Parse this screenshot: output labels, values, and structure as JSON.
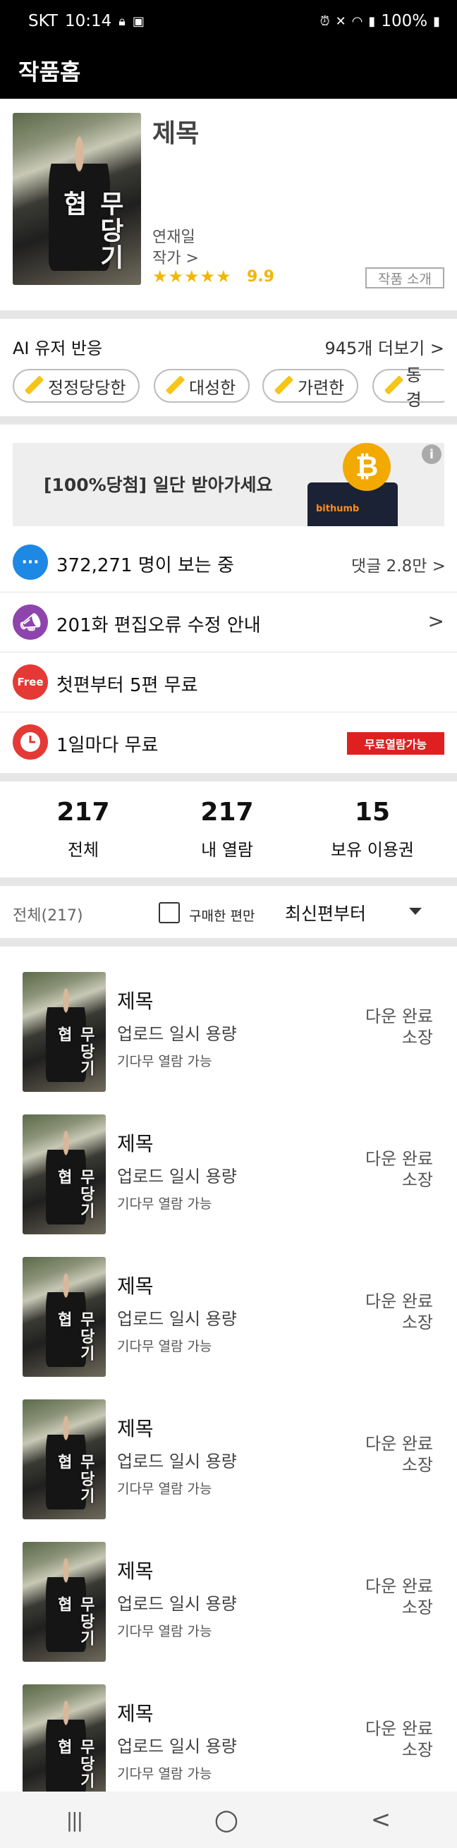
{
  "status_bar": {
    "carrier": "SKT",
    "time": "10:14",
    "battery": "100%"
  },
  "app_bar": {
    "title": "작품홈"
  },
  "work": {
    "title": "제목",
    "cover_text": "무당기협",
    "serial_day": "연재일",
    "author": "작가 >",
    "stars": "★★★★★",
    "rating": "9.9",
    "intro_button": "작품 소개"
  },
  "ai_reaction": {
    "label": "AI 유저 반응",
    "more": "945개 더보기 >",
    "chips": [
      "정정당당한",
      "대성한",
      "가련한",
      "동경"
    ]
  },
  "ad": {
    "text": "[100%당첨] 일단 받아가세요",
    "coin_label": "₿",
    "wallet_label": "bithumb",
    "info_icon": "i"
  },
  "rows": [
    {
      "icon": "chat-icon",
      "icon_color": "#1e88e5",
      "text": "372,271 명이 보는 중",
      "right": "댓글 2.8만 >"
    },
    {
      "icon": "megaphone-icon",
      "icon_color": "#8e44ad",
      "text": "201화 편집오류 수정 안내",
      "right": ">"
    },
    {
      "icon": "free-icon",
      "icon_color": "#e53935",
      "icon_label": "Free",
      "text": "첫편부터 5편 무료",
      "right": ""
    },
    {
      "icon": "clock-icon",
      "icon_color": "#e53935",
      "text": "1일마다 무료",
      "badge": "무료열람가능"
    }
  ],
  "stats": [
    {
      "value": "217",
      "label": "전체"
    },
    {
      "value": "217",
      "label": "내 열람"
    },
    {
      "value": "15",
      "label": "보유 이용권"
    }
  ],
  "filter": {
    "total": "전체(217)",
    "purchased_only": "구매한 편만",
    "sort": "최신편부터"
  },
  "episodes": [
    {
      "title": "제목",
      "meta": "업로드 일시   용량",
      "sub": "기다무 열람 가능",
      "status_1": "다운 완료",
      "status_2": "소장"
    },
    {
      "title": "제목",
      "meta": "업로드 일시   용량",
      "sub": "기다무 열람 가능",
      "status_1": "다운 완료",
      "status_2": "소장"
    },
    {
      "title": "제목",
      "meta": "업로드 일시   용량",
      "sub": "기다무 열람 가능",
      "status_1": "다운 완료",
      "status_2": "소장"
    },
    {
      "title": "제목",
      "meta": "업로드 일시   용량",
      "sub": "기다무 열람 가능",
      "status_1": "다운 완료",
      "status_2": "소장"
    },
    {
      "title": "제목",
      "meta": "업로드 일시   용량",
      "sub": "기다무 열람 가능",
      "status_1": "다운 완료",
      "status_2": "소장"
    },
    {
      "title": "제목",
      "meta": "업로드 일시   용량",
      "sub": "기다무 열람 가능",
      "status_1": "다운 완료",
      "status_2": "소장"
    }
  ],
  "nav": {
    "recent": "|||",
    "home": "○",
    "back": "<"
  }
}
